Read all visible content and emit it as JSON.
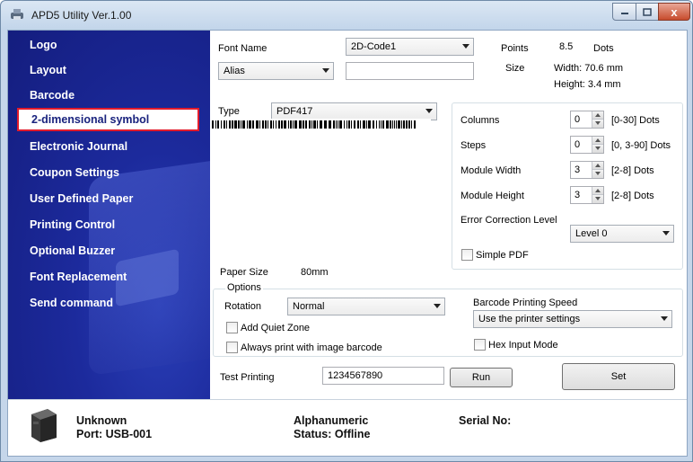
{
  "window": {
    "title": "APD5 Utility Ver.1.00",
    "close_glyph": "x"
  },
  "sidebar": {
    "items": [
      {
        "label": "Logo"
      },
      {
        "label": "Layout"
      },
      {
        "label": "Barcode"
      },
      {
        "label": "2-dimensional symbol",
        "selected": true
      },
      {
        "label": "Electronic Journal"
      },
      {
        "label": "Coupon Settings"
      },
      {
        "label": "User Defined Paper"
      },
      {
        "label": "Printing Control"
      },
      {
        "label": "Optional Buzzer"
      },
      {
        "label": "Font Replacement"
      },
      {
        "label": "Send command"
      }
    ]
  },
  "font": {
    "name_label": "Font Name",
    "name_value": "2D-Code1",
    "alias_value": "Alias",
    "alias_text": "",
    "points_label": "Points",
    "points_value": "8.5",
    "points_unit": "Dots",
    "size_label": "Size",
    "width_text": "Width: 70.6 mm",
    "height_text": "Height: 3.4 mm"
  },
  "symbol": {
    "type_label": "Type",
    "type_value": "PDF417",
    "paper_size_label": "Paper Size",
    "paper_size_value": "80mm"
  },
  "params": {
    "columns_label": "Columns",
    "columns_value": "0",
    "columns_range": "[0-30] Dots",
    "steps_label": "Steps",
    "steps_value": "0",
    "steps_range": "[0, 3-90] Dots",
    "module_width_label": "Module Width",
    "module_width_value": "3",
    "module_width_range": "[2-8] Dots",
    "module_height_label": "Module Height",
    "module_height_value": "3",
    "module_height_range": "[2-8] Dots",
    "ecl_label": "Error Correction Level",
    "ecl_value": "Level 0",
    "simple_pdf_label": "Simple PDF"
  },
  "options": {
    "title": "Options",
    "rotation_label": "Rotation",
    "rotation_value": "Normal",
    "quiet_zone_label": "Add Quiet Zone",
    "image_barcode_label": "Always print with image barcode",
    "speed_label": "Barcode Printing Speed",
    "speed_value": "Use the printer settings",
    "hex_label": "Hex Input Mode"
  },
  "test": {
    "label": "Test Printing",
    "value": "1234567890",
    "run_label": "Run",
    "set_label": "Set"
  },
  "status": {
    "printer_name": "Unknown",
    "port": "Port: USB-001",
    "mode": "Alphanumeric",
    "status": "Status: Offline",
    "serial": "Serial No:"
  }
}
